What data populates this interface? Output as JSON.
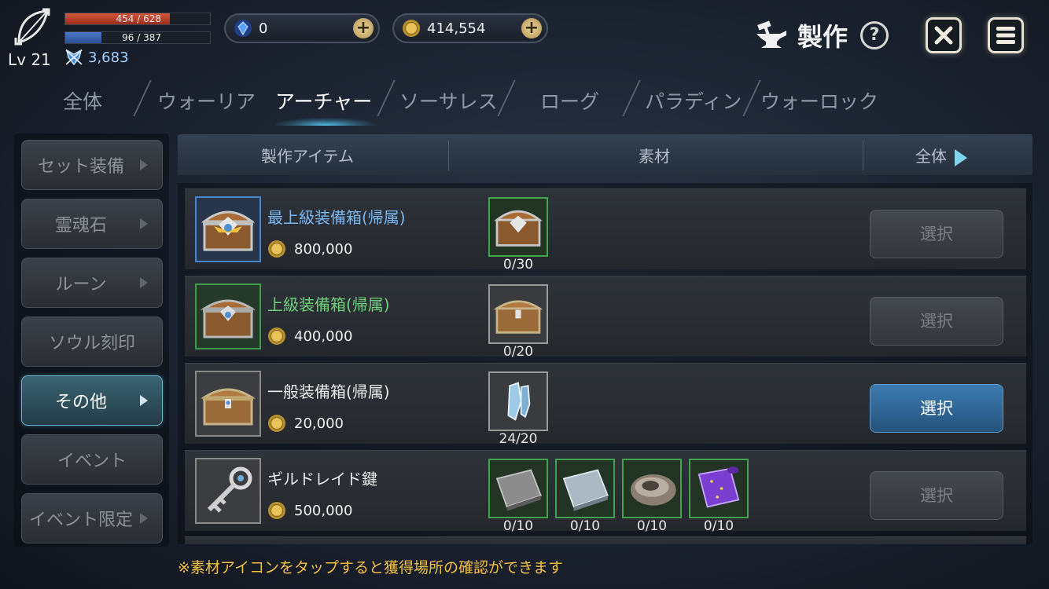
{
  "player": {
    "level": "Lv 21",
    "hp_text": "454 / 628",
    "hp_ratio": 0.723,
    "mp_text": "96 / 387",
    "mp_ratio": 0.248,
    "combat_power": "3,683"
  },
  "currency": {
    "gems": "0",
    "gold": "414,554"
  },
  "header": {
    "title": "製作"
  },
  "class_tabs": [
    {
      "label": "全体",
      "active": false
    },
    {
      "label": "ウォーリア",
      "active": false
    },
    {
      "label": "アーチャー",
      "active": true
    },
    {
      "label": "ソーサレス",
      "active": false
    },
    {
      "label": "ローグ",
      "active": false
    },
    {
      "label": "パラディン",
      "active": false
    },
    {
      "label": "ウォーロック",
      "active": false
    }
  ],
  "categories": [
    {
      "label": "セット装備",
      "active": false
    },
    {
      "label": "霊魂石",
      "active": false
    },
    {
      "label": "ルーン",
      "active": false
    },
    {
      "label": "ソウル刻印",
      "active": false
    },
    {
      "label": "その他",
      "active": true
    },
    {
      "label": "イベント",
      "active": false
    },
    {
      "label": "イベント限定",
      "active": false
    }
  ],
  "columns": {
    "item": "製作アイテム",
    "materials": "素材",
    "filter": "全体"
  },
  "items": [
    {
      "name": "最上級装備箱(帰属)",
      "rarity": "blue",
      "price": "800,000",
      "materials": [
        {
          "count": "0/30",
          "icon": "premium-chest-icon"
        }
      ],
      "select_label": "選択",
      "enabled": false
    },
    {
      "name": "上級装備箱(帰属)",
      "rarity": "green",
      "price": "400,000",
      "materials": [
        {
          "count": "0/20",
          "icon": "normal-chest-icon"
        }
      ],
      "select_label": "選択",
      "enabled": false
    },
    {
      "name": "一般装備箱(帰属)",
      "rarity": "gray",
      "price": "20,000",
      "materials": [
        {
          "count": "24/20",
          "icon": "gauntlet-fragment-icon"
        }
      ],
      "select_label": "選択",
      "enabled": true
    },
    {
      "name": "ギルドレイド鍵",
      "rarity": "gray",
      "price": "500,000",
      "materials": [
        {
          "count": "0/10",
          "icon": "steel-plate-icon"
        },
        {
          "count": "0/10",
          "icon": "silver-plate-icon"
        },
        {
          "count": "0/10",
          "icon": "fur-pelt-icon"
        },
        {
          "count": "0/10",
          "icon": "purple-scroll-icon"
        }
      ],
      "select_label": "選択",
      "enabled": false
    }
  ],
  "note": "※素材アイコンをタップすると獲得場所の確認ができます",
  "colors": {
    "accent_cyan": "#53c4f0",
    "gold_text": "#f2c040",
    "rarity_blue": "#79b7f2",
    "rarity_green": "#6dd17a"
  }
}
